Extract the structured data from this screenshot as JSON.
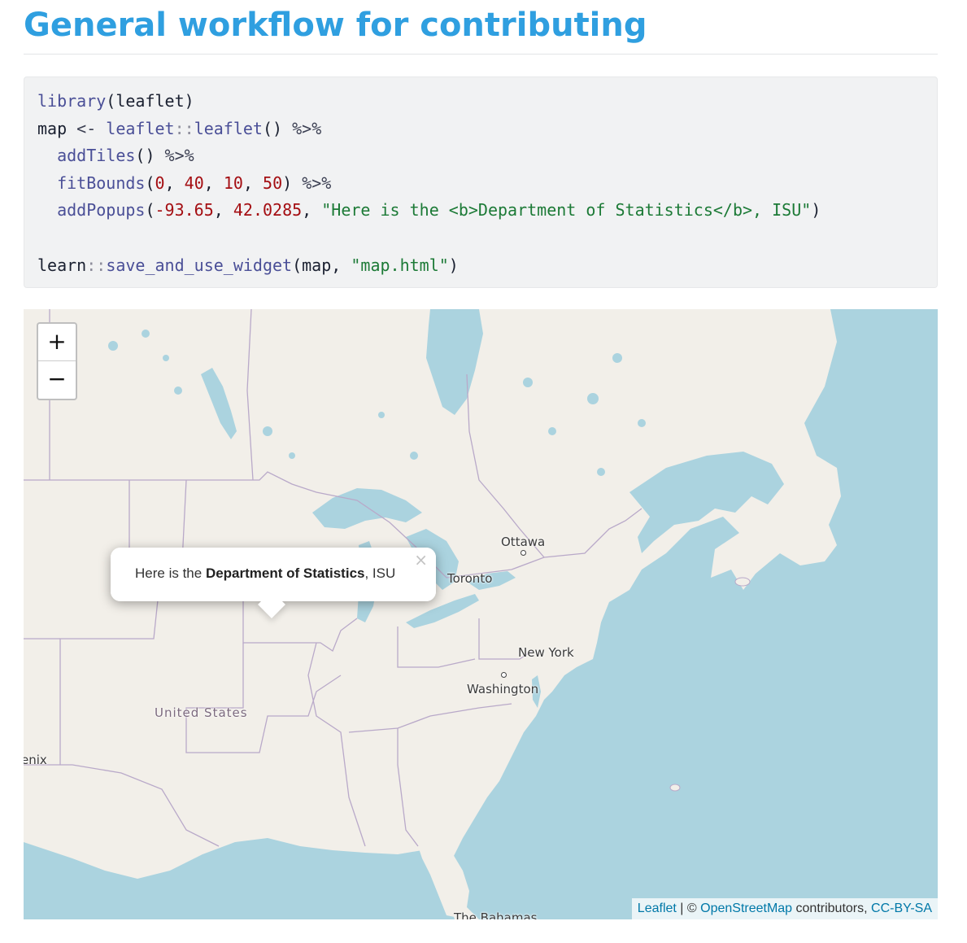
{
  "page": {
    "title": "General workflow for contributing"
  },
  "code": {
    "line1": {
      "fn": "library",
      "open": "(",
      "arg": "leaflet",
      "close": ")"
    },
    "line2": {
      "lhs": "map",
      "assign": " <- ",
      "ns": "leaflet",
      "sep": "::",
      "fn": "leaflet",
      "call": "()",
      "pipe": " %>%"
    },
    "line3": {
      "indent": "  ",
      "fn": "addTiles",
      "call": "()",
      "pipe": " %>%"
    },
    "line4": {
      "indent": "  ",
      "fn": "fitBounds",
      "open": "(",
      "n1": "0",
      "c1": ", ",
      "n2": "40",
      "c2": ", ",
      "n3": "10",
      "c3": ", ",
      "n4": "50",
      "close": ")",
      "pipe": " %>%"
    },
    "line5": {
      "indent": "  ",
      "fn": "addPopups",
      "open": "(",
      "n1": "-93.65",
      "c1": ", ",
      "n2": "42.0285",
      "c2": ", ",
      "str": "\"Here is the <b>Department of Statistics</b>, ISU\"",
      "close": ")"
    },
    "line7": {
      "ns": "learn",
      "sep": "::",
      "fn": "save_and_use_widget",
      "open": "(",
      "arg": "map, ",
      "str": "\"map.html\"",
      "close": ")"
    }
  },
  "map": {
    "zoom_in": "+",
    "zoom_out": "−",
    "popup": {
      "prefix": "Here is the ",
      "bold": "Department of Statistics",
      "suffix": ", ISU",
      "close": "×"
    },
    "labels": {
      "ottawa": "Ottawa",
      "toronto": "Toronto",
      "new_york": "New York",
      "washington": "Washington",
      "united_states": "United States",
      "phoenix_partial": "enix",
      "bahamas": "The Bahamas"
    },
    "attribution": {
      "leaflet": "Leaflet",
      "sep": " | © ",
      "osm": "OpenStreetMap",
      "contributors": " contributors, ",
      "license": "CC-BY-SA"
    },
    "colors": {
      "water": "#abd3df",
      "land": "#f2efe9",
      "border": "#b9a9c9"
    }
  }
}
